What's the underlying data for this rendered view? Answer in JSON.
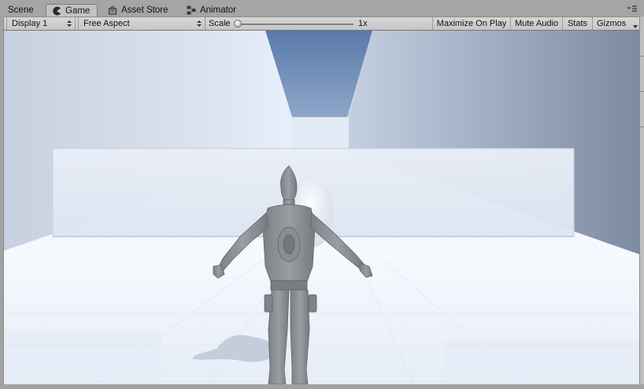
{
  "tabs": [
    {
      "label": "Scene",
      "icon": "none",
      "active": false
    },
    {
      "label": "Game",
      "icon": "pacman-icon",
      "active": true
    },
    {
      "label": "Asset Store",
      "icon": "shopping-bag-icon",
      "active": false
    },
    {
      "label": "Animator",
      "icon": "animator-nodes-icon",
      "active": false
    }
  ],
  "toolbar": {
    "display_value": "Display 1",
    "aspect_value": "Free Aspect",
    "scale_label": "Scale",
    "scale_value": "1x",
    "scale_fraction": 0.0,
    "maximize_on_play_label": "Maximize On Play",
    "mute_audio_label": "Mute Audio",
    "stats_label": "Stats",
    "gizmos_label": "Gizmos"
  },
  "colors": {
    "tab_strip": "#a5a5a5",
    "toolbar": "#cbcbcb",
    "sky": "#5e7fae",
    "wall_light": "#dbe3f0",
    "floor": "#f4f7fc",
    "character": "#8b8f93"
  }
}
